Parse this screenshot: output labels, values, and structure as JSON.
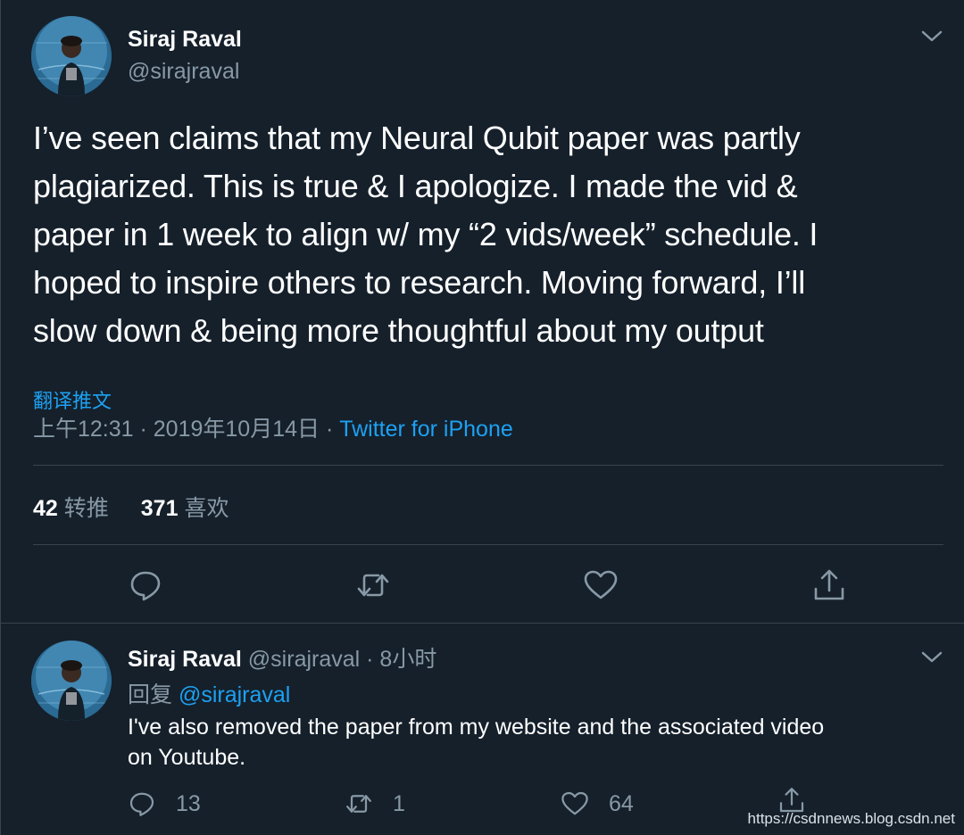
{
  "main_tweet": {
    "author_name": "Siraj Raval",
    "author_handle": "@sirajraval",
    "text_lines": [
      "I’ve seen claims that my Neural Qubit paper was partly",
      "plagiarized. This is true & I apologize. I made the vid &",
      "paper in 1 week to align w/ my “2 vids/week” schedule. I",
      "hoped to inspire others to research. Moving forward, I’ll",
      "slow down & being more thoughtful about my output"
    ],
    "translate_label": "翻译推文",
    "timestamp": "上午12:31 · 2019年10月14日 · ",
    "source": "Twitter for iPhone",
    "retweets_count": "42",
    "retweets_label": "转推",
    "likes_count": "371",
    "likes_label": "喜欢",
    "actions": [
      "reply-icon",
      "retweet-icon",
      "like-icon",
      "share-icon"
    ]
  },
  "reply_tweet": {
    "author_name": "Siraj Raval",
    "author_handle": " @sirajraval · 8小时",
    "replying_label": "回复 ",
    "replying_to": "@sirajraval",
    "text_lines": [
      "I've also removed the paper from my website and the associated video",
      "on Youtube."
    ],
    "reply_count": "13",
    "retweet_count": "1",
    "like_count": "64"
  },
  "watermark": "https://csdnnews.blog.csdn.net",
  "colors": {
    "background": "#15202b",
    "text": "#ffffff",
    "muted": "#8899a6",
    "accent": "#1da1f2",
    "divider": "#38444d"
  }
}
